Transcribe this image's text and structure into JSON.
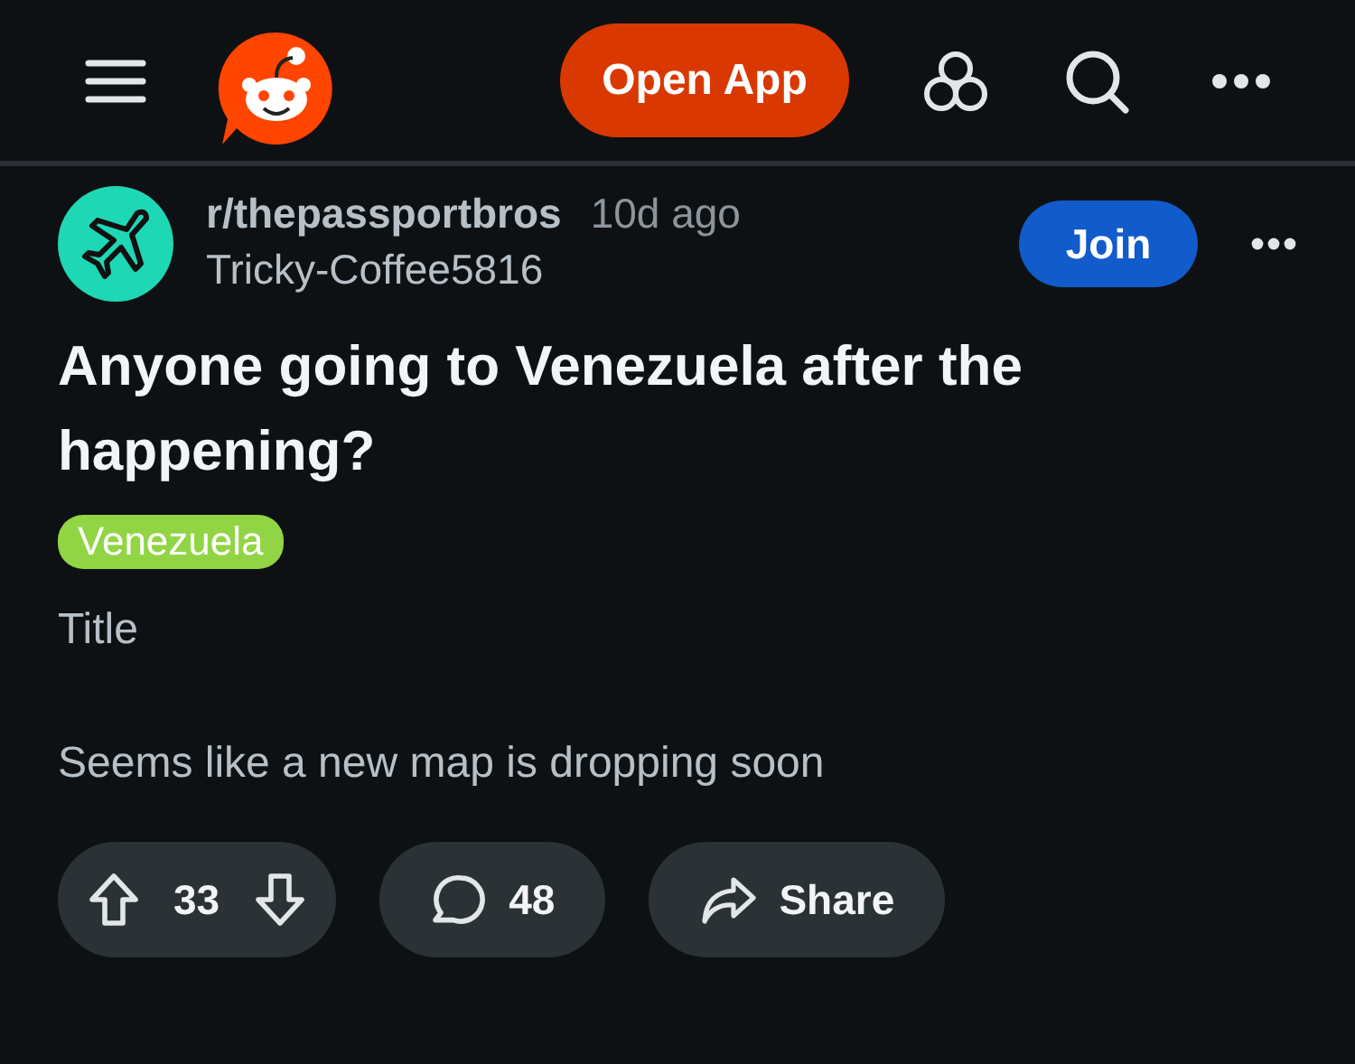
{
  "header": {
    "open_app_label": "Open App"
  },
  "post": {
    "subreddit": "r/thepassportbros",
    "age": "10d ago",
    "author": "Tricky-Coffee5816",
    "join_label": "Join",
    "title": "Anyone going to Venezuela after the happening?",
    "flair": "Venezuela",
    "body_heading": "Title",
    "body": "Seems like a new map is dropping soon",
    "votes": "33",
    "comments": "48",
    "share_label": "Share"
  }
}
